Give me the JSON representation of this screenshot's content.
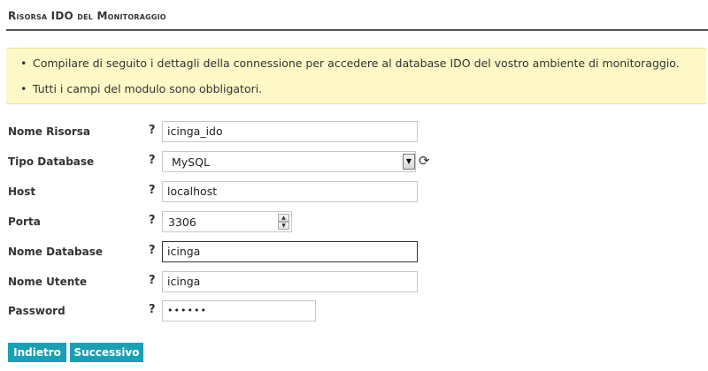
{
  "page": {
    "title": "Risorsa IDO del Monitoraggio"
  },
  "notice": {
    "items": [
      "Compilare di seguito i dettagli della connessione per accedere al database IDO del vostro ambiente di monitoraggio.",
      "Tutti i campi del modulo sono obbligatori."
    ],
    "bullet": "•"
  },
  "help_glyph": "?",
  "form": {
    "resource_name": {
      "label": "Nome Risorsa",
      "value": "icinga_ido"
    },
    "db_type": {
      "label": "Tipo Database",
      "value": "MySQL"
    },
    "host": {
      "label": "Host",
      "value": "localhost"
    },
    "port": {
      "label": "Porta",
      "value": "3306"
    },
    "db_name": {
      "label": "Nome Database",
      "value": "icinga"
    },
    "username": {
      "label": "Nome Utente",
      "value": "icinga"
    },
    "password": {
      "label": "Password",
      "value": "••••••"
    }
  },
  "buttons": {
    "back": "Indietro",
    "next": "Successivo"
  },
  "colors": {
    "accent": "#1b9fb3",
    "notice_bg": "#fdf8c6"
  }
}
